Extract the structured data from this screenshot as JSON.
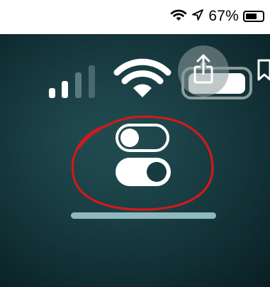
{
  "status_bar": {
    "battery_percent_label": "67%",
    "battery_level": 0.67,
    "icons": [
      "wifi-icon",
      "location-arrow-icon",
      "battery-icon"
    ]
  },
  "photo": {
    "description_icons": [
      "cellular-signal-icon",
      "wifi-icon",
      "battery-icon",
      "share-icon",
      "bookmark-icon",
      "toggle-off-icon",
      "toggle-on-icon",
      "home-indicator"
    ],
    "annotation_color": "#d11a1a",
    "accent_colors": {
      "background": "#163b40",
      "foreground": "#ffffff",
      "home_indicator": "#8fb9bf"
    }
  }
}
